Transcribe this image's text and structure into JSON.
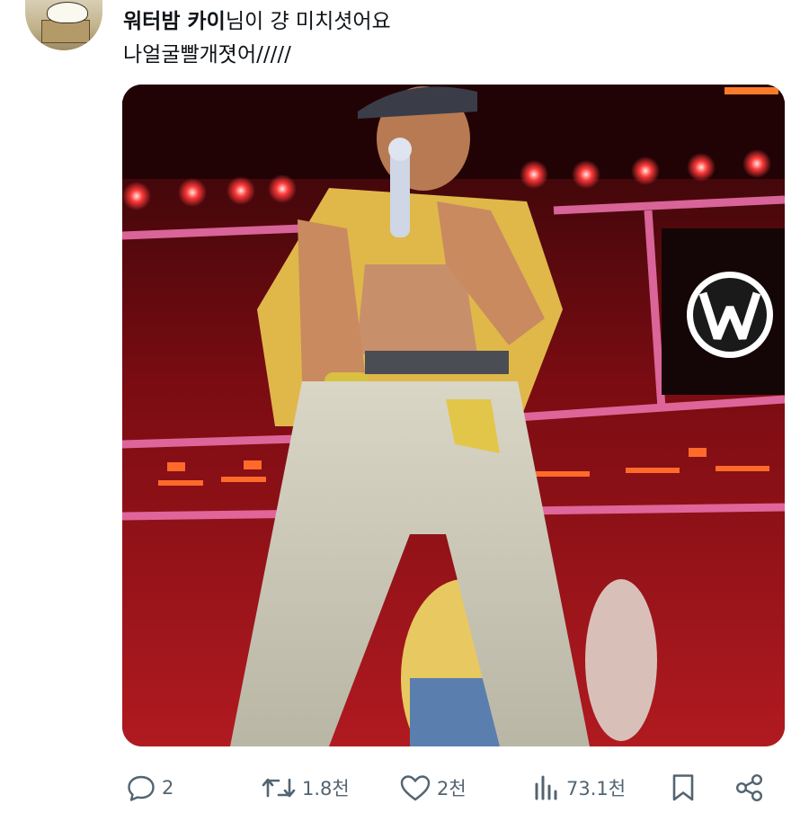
{
  "post": {
    "display_name": "워터밤 카이",
    "headline_rest": "님이 걍 미치셧어요",
    "body_text": "나얼굴빨개졋어/////"
  },
  "media": {
    "logo_letter": "W",
    "sound_state": "muted"
  },
  "actions": {
    "reply_count": "2",
    "repost_count": "1.8천",
    "like_count": "2천",
    "view_count": "73.1천"
  },
  "icons": [
    "avatar",
    "speaker-muted-icon",
    "reply-icon",
    "repost-icon",
    "like-icon",
    "views-icon",
    "bookmark-icon",
    "share-icon"
  ],
  "colors": {
    "text": "#0f1419",
    "secondary": "#536471",
    "stage_red": "#c21820"
  }
}
